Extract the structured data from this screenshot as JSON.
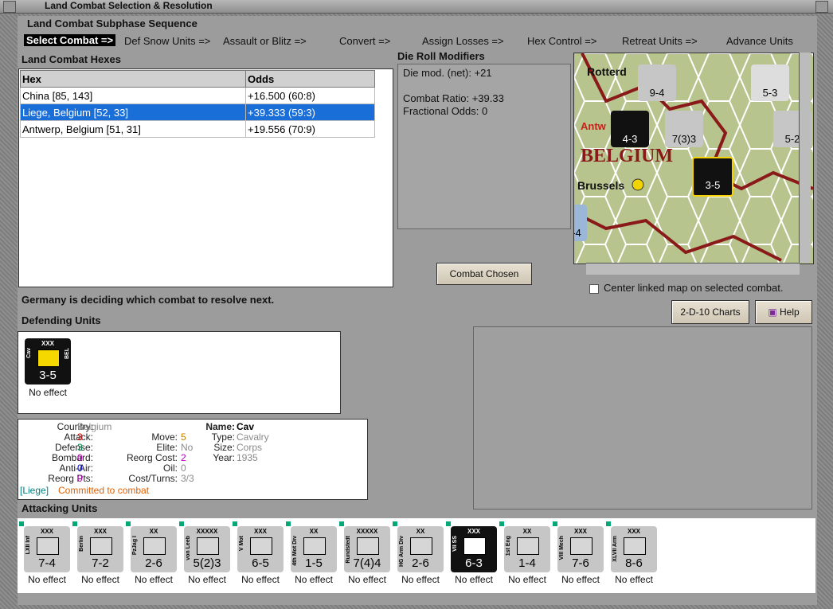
{
  "window": {
    "title": "Land Combat Selection & Resolution"
  },
  "sequence": {
    "title": "Land Combat Subphase Sequence",
    "phases": [
      "Select Combat =>",
      "Def Snow Units =>",
      "Assault or Blitz =>",
      "Convert =>",
      "Assign Losses =>",
      "Hex Control =>",
      "Retreat Units =>",
      "Advance Units"
    ]
  },
  "hexes": {
    "title": "Land Combat Hexes",
    "columns": [
      "Hex",
      "Odds"
    ],
    "rows": [
      {
        "hex": "China [85, 143]",
        "odds": "+16.500 (60:8)",
        "selected": false
      },
      {
        "hex": "Liege, Belgium [52, 33]",
        "odds": "+39.333 (59:3)",
        "selected": true
      },
      {
        "hex": "Antwerp, Belgium [51, 31]",
        "odds": "+19.556 (70:9)",
        "selected": false
      }
    ]
  },
  "modifiers": {
    "title": "Die Roll Modifiers",
    "die_mod": "Die mod. (net): +21",
    "combat_ratio": "Combat Ratio: +39.33",
    "fractional_odds": "Fractional Odds: 0"
  },
  "buttons": {
    "combat_chosen": "Combat Chosen",
    "charts": "2-D-10 Charts",
    "help": "Help"
  },
  "map": {
    "labels": [
      "Rotterd",
      "Antw",
      "BELGIUM",
      "Brussels"
    ],
    "counters": [
      "9-4",
      "5-3",
      "4-3",
      "7(3)3",
      "3-5",
      "5-2",
      "-4"
    ]
  },
  "center_linked": "Center linked map on selected combat.",
  "status": "Germany is deciding which combat to resolve next.",
  "defending": {
    "title": "Defending Units",
    "units": [
      {
        "side": "Cav",
        "flag": "BEL",
        "size": "XXX",
        "value": "3-5",
        "effect": "No effect"
      }
    ]
  },
  "unit_info": {
    "country_label": "Country:",
    "country": "Belgium",
    "attack_label": "Attack:",
    "attack": "3",
    "defense_label": "Defense:",
    "defense": "3",
    "bombard_label": "Bombard:",
    "bombard": "0",
    "antiair_label": "Anti-Air:",
    "antiair": "0",
    "reorg_pts_label": "Reorg Pts:",
    "reorg_pts": "0",
    "move_label": "Move:",
    "move": "5",
    "elite_label": "Elite:",
    "elite": "No",
    "reorg_cost_label": "Reorg Cost:",
    "reorg_cost": "2",
    "oil_label": "Oil:",
    "oil": "0",
    "cost_turns_label": "Cost/Turns:",
    "cost_turns": "3/3",
    "name_label": "Name:",
    "name": "Cav",
    "type_label": "Type:",
    "type": "Cavalry",
    "size_label": "Size:",
    "size": "Corps",
    "year_label": "Year:",
    "year": "1935",
    "location": "[Liege]",
    "committed": "Committed to combat"
  },
  "attacking": {
    "title": "Attacking Units",
    "units": [
      {
        "side": "LXII Inf",
        "size": "XXX",
        "value": "7-4",
        "effect": "No effect"
      },
      {
        "side": "Berlin",
        "size": "XXX",
        "value": "7-2",
        "effect": "No effect"
      },
      {
        "side": "PzJag I",
        "size": "XX",
        "value": "2-6",
        "effect": "No effect"
      },
      {
        "side": "von Leeb",
        "size": "XXXXX",
        "value": "5(2)3",
        "effect": "No effect"
      },
      {
        "side": "V Mot",
        "size": "XXX",
        "value": "6-5",
        "effect": "No effect"
      },
      {
        "side": "4th Mot Div",
        "size": "XX",
        "value": "1-5",
        "effect": "No effect"
      },
      {
        "side": "Rundstedt",
        "size": "XXXXX",
        "value": "7(4)4",
        "effect": "No effect"
      },
      {
        "side": "HG Arm Div",
        "size": "XX",
        "value": "2-6",
        "effect": "No effect"
      },
      {
        "side": "VII SS",
        "size": "XXX",
        "value": "6-3",
        "effect": "No effect"
      },
      {
        "side": "1st Eng",
        "size": "XX",
        "value": "1-4",
        "effect": "No effect"
      },
      {
        "side": "VIII Mech",
        "size": "XXX",
        "value": "7-6",
        "effect": "No effect"
      },
      {
        "side": "XLVII Arm",
        "size": "XXX",
        "value": "8-6",
        "effect": "No effect"
      }
    ]
  },
  "colors": {
    "selection": "#1a6ed8",
    "attack": "#cc0000",
    "defense": "#00884a",
    "move": "#c08000",
    "bombard": "#b000b0",
    "committed": "#e06000",
    "location": "#008080"
  }
}
